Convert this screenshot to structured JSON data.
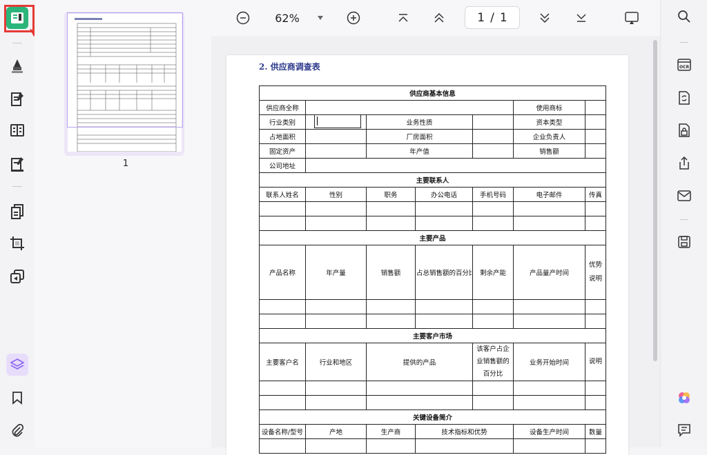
{
  "toolbar": {
    "zoom": "62%",
    "page_current": "1",
    "page_sep": "/",
    "page_total": "1"
  },
  "thumbnail": {
    "label": "1"
  },
  "document": {
    "title": "2. 供应商调查表",
    "basic": {
      "header": "供应商基本信息",
      "r1": [
        "供应商全称",
        "使用商标"
      ],
      "r2": [
        "行业类别",
        "业务性质",
        "资本类型"
      ],
      "r3": [
        "占地面积",
        "厂房面积",
        "企业负责人"
      ],
      "r4": [
        "固定资产",
        "年产值",
        "销售额"
      ],
      "r5": [
        "公司地址"
      ]
    },
    "contacts": {
      "header": "主要联系人",
      "cols": [
        "联系人姓名",
        "性别",
        "职务",
        "办公电话",
        "手机号码",
        "电子邮件",
        "传真"
      ]
    },
    "products": {
      "header": "主要产品",
      "cols": [
        "产品名称",
        "年产量",
        "销售额",
        "占总销售额的百分比",
        "剩余产能",
        "产品量产时间",
        "优势说明"
      ]
    },
    "markets": {
      "header": "主要客户市场",
      "cols": [
        "主要客户名",
        "行业和地区",
        "提供的产品",
        "该客户占企业销售额的百分比",
        "业务开始时间",
        "说明"
      ]
    },
    "equipment": {
      "header": "关键设备简介",
      "cols": [
        "设备名称/型号",
        "产地",
        "生产商",
        "技术指标和优势",
        "设备生产时间",
        "数量"
      ]
    }
  },
  "icons": {
    "left": [
      "reader-icon",
      "highlighter-icon",
      "edit-pdf-icon",
      "form-icon",
      "fill-sign-icon",
      "organize-pages-icon",
      "crop-icon",
      "convert-icon",
      "layers-icon",
      "bookmark-icon",
      "attachment-icon"
    ],
    "right": [
      "search-icon",
      "ocr-icon",
      "convert-icon",
      "protect-icon",
      "share-icon",
      "email-icon",
      "save-icon",
      "ai-icon",
      "comment-icon"
    ]
  },
  "colors": {
    "accent": "#8a63f0",
    "active_green": "#2bb57a",
    "callout_red": "#e53935",
    "title_blue": "#2d3a8c"
  }
}
